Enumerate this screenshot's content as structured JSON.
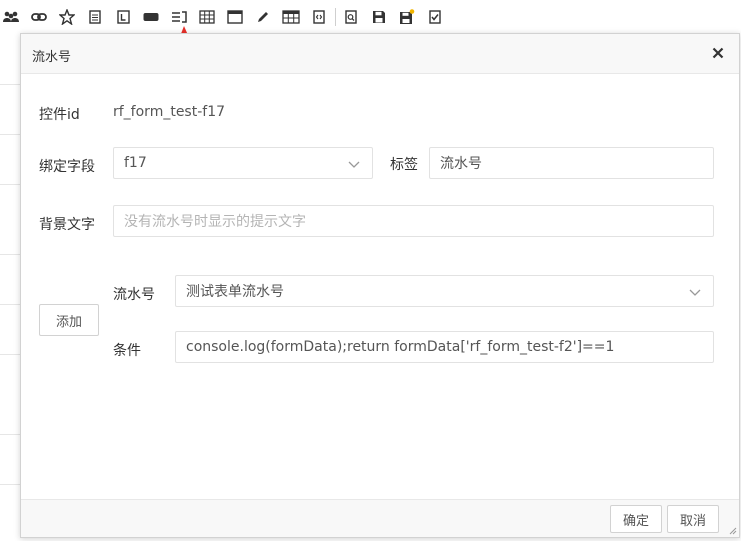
{
  "toolbar": {
    "icons": [
      "users-icon",
      "link-icon",
      "star-icon",
      "document-icon",
      "label-icon",
      "button-icon",
      "serial-number-icon",
      "table-grid-icon",
      "window-icon",
      "pencil-icon",
      "table-icon",
      "code-file-icon",
      "preview-icon",
      "save-icon",
      "save-new-icon",
      "checklist-icon"
    ]
  },
  "dialog": {
    "title": "流水号",
    "control_id_label": "控件id",
    "control_id_value": "rf_form_test-f17",
    "bind_field_label": "绑定字段",
    "bind_field_value": "f17",
    "tag_label": "标签",
    "tag_value": "流水号",
    "bg_text_label": "背景文字",
    "bg_text_placeholder": "没有流水号时显示的提示文字",
    "add_button": "添加",
    "serial_label": "流水号",
    "serial_value": "测试表单流水号",
    "condition_label": "条件",
    "condition_value": "console.log(formData);return formData['rf_form_test-f2']==1",
    "ok_button": "确定",
    "cancel_button": "取消"
  },
  "colors": {
    "arrow": "#e8302a"
  }
}
